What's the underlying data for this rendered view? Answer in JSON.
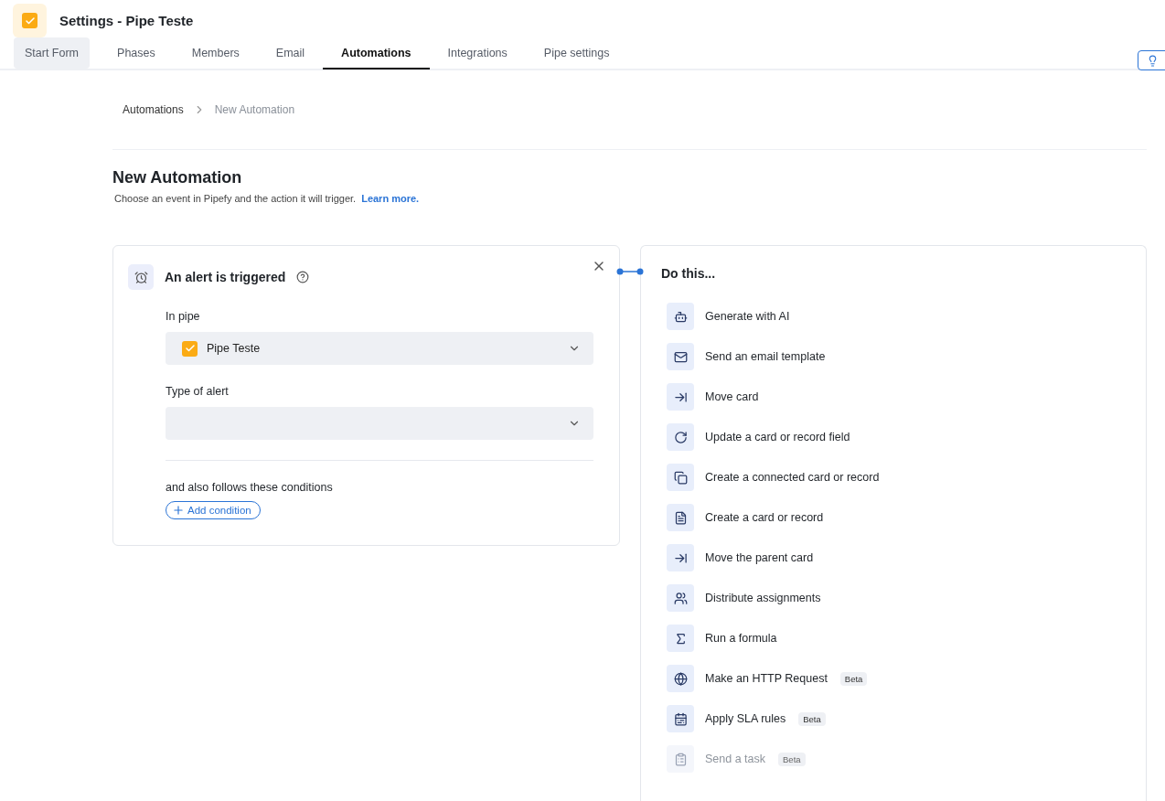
{
  "header": {
    "title": "Settings - Pipe Teste"
  },
  "tabs": [
    {
      "label": "Start Form",
      "selected": false,
      "hovered": true
    },
    {
      "label": "Phases",
      "selected": false,
      "hovered": false
    },
    {
      "label": "Members",
      "selected": false,
      "hovered": false
    },
    {
      "label": "Email",
      "selected": false,
      "hovered": false
    },
    {
      "label": "Automations",
      "selected": true,
      "hovered": false
    },
    {
      "label": "Integrations",
      "selected": false,
      "hovered": false
    },
    {
      "label": "Pipe settings",
      "selected": false,
      "hovered": false
    }
  ],
  "breadcrumb": [
    {
      "label": "Automations",
      "current": false
    },
    {
      "label": "New Automation",
      "current": true
    }
  ],
  "page": {
    "title": "New Automation",
    "description": "Choose an event in Pipefy and the action it will trigger.",
    "link": "Learn more."
  },
  "trigger": {
    "title": "An alert is triggered",
    "fields": [
      {
        "label": "In pipe",
        "value": "Pipe Teste"
      },
      {
        "label": "Type of alert"
      }
    ],
    "conditions_label": "and also follows these conditions",
    "add_button": "Add condition"
  },
  "actions": {
    "title": "Do this...",
    "items": [
      {
        "kind": "ai",
        "label": "Generate with AI",
        "disabled": false
      },
      {
        "kind": "email",
        "label": "Send an email template",
        "disabled": false
      },
      {
        "kind": "move",
        "label": "Move card",
        "disabled": false
      },
      {
        "kind": "update",
        "label": "Update a card or record field",
        "disabled": false
      },
      {
        "kind": "connected",
        "label": "Create a connected card or record",
        "disabled": false
      },
      {
        "kind": "create",
        "label": "Create a card or record",
        "disabled": false
      },
      {
        "kind": "move",
        "label": "Move the parent card",
        "disabled": false
      },
      {
        "kind": "users",
        "label": "Distribute assignments",
        "disabled": false
      },
      {
        "kind": "formula",
        "label": "Run a formula",
        "disabled": false
      },
      {
        "kind": "globe",
        "label": "Make an HTTP Request",
        "badge": "Beta",
        "disabled": false
      },
      {
        "kind": "calendar",
        "label": "Apply SLA rules",
        "badge": "Beta",
        "disabled": false
      },
      {
        "kind": "task",
        "label": "Send a task",
        "badge": "Beta",
        "disabled": true
      }
    ]
  }
}
